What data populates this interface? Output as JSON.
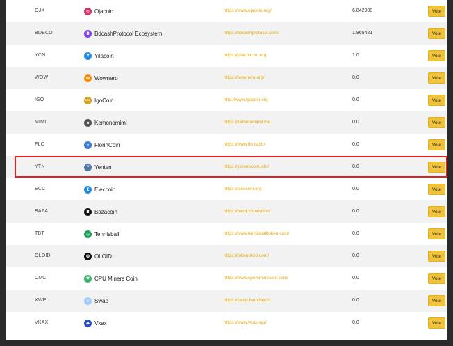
{
  "rows": [
    {
      "ticker": "OJX",
      "name": "Ojacoin",
      "url": "https://www.ojacoin.org/",
      "score": "6.842908",
      "vote": "Vote",
      "icon": "ojacoin-icon",
      "icon_color": "#d6336c",
      "icon_glyph": "∞"
    },
    {
      "ticker": "BDECO",
      "name": "BdcashProtocol Ecosystem",
      "url": "https://bdcashprotocol.com/",
      "score": "1.865421",
      "vote": "Vote",
      "icon": "bdcash-icon",
      "icon_color": "#7b3fe4",
      "icon_glyph": "B"
    },
    {
      "ticker": "YCN",
      "name": "Yilacoin",
      "url": "https://yilacoin.eu.org",
      "score": "1.0",
      "vote": "Vote",
      "icon": "yilacoin-icon",
      "icon_color": "#1e88e5",
      "icon_glyph": "Y"
    },
    {
      "ticker": "WOW",
      "name": "Wownero",
      "url": "https://wownero.org/",
      "score": "0.0",
      "vote": "Vote",
      "icon": "wownero-icon",
      "icon_color": "#ff8a00",
      "icon_glyph": "w"
    },
    {
      "ticker": "IGO",
      "name": "IgoCoin",
      "url": "http://www.igocoin.org",
      "score": "0.0",
      "vote": "Vote",
      "icon": "igocoin-icon",
      "icon_color": "#d4a017",
      "icon_glyph": "IGO"
    },
    {
      "ticker": "MIMI",
      "name": "Kemonomimi",
      "url": "https://kemonomimi.me",
      "score": "0.0",
      "vote": "Vote",
      "icon": "kemonomimi-icon",
      "icon_color": "#555555",
      "icon_glyph": "◆"
    },
    {
      "ticker": "FLO",
      "name": "FlorinCoin",
      "url": "https://www.flo.cash/",
      "score": "0.0",
      "vote": "Vote",
      "icon": "florincoin-icon",
      "icon_color": "#3a7bd5",
      "icon_glyph": "✦"
    },
    {
      "ticker": "YTN",
      "name": "Yenten",
      "url": "https://yentencoin.info/",
      "score": "0.0",
      "vote": "Vote",
      "icon": "yenten-icon",
      "icon_color": "#4a7aa8",
      "icon_glyph": "Y"
    },
    {
      "ticker": "ECC",
      "name": "Eleccoin",
      "url": "https://eleccoin.org",
      "score": "0.0",
      "vote": "Vote",
      "icon": "eleccoin-icon",
      "icon_color": "#1e88e5",
      "icon_glyph": "E"
    },
    {
      "ticker": "BAZA",
      "name": "Bazacoin",
      "url": "https://baza.foundation/",
      "score": "0.0",
      "vote": "Vote",
      "icon": "bazacoin-icon",
      "icon_color": "#111111",
      "icon_glyph": "B"
    },
    {
      "ticker": "TBT",
      "name": "Tennisball",
      "url": "https://www.tennisballtoken.com/",
      "score": "0.0",
      "vote": "Vote",
      "icon": "tennisball-icon",
      "icon_color": "#1b9e5a",
      "icon_glyph": "◎"
    },
    {
      "ticker": "OLOID",
      "name": "OLOID",
      "url": "https://tokenoloid.com/",
      "score": "0.0",
      "vote": "Vote",
      "icon": "oloid-icon",
      "icon_color": "#111111",
      "icon_glyph": "O"
    },
    {
      "ticker": "CMC",
      "name": "CPU Miners Coin",
      "url": "https://www.cpuminerscoin.com/",
      "score": "0.0",
      "vote": "Vote",
      "icon": "cpuminers-icon",
      "icon_color": "#3cb371",
      "icon_glyph": "♥"
    },
    {
      "ticker": "XWP",
      "name": "Swap",
      "url": "https://swap.foundation",
      "score": "0.0",
      "vote": "Vote",
      "icon": "swap-icon",
      "icon_color": "#9ecbff",
      "icon_glyph": "✕"
    },
    {
      "ticker": "VKAX",
      "name": "Vkax",
      "url": "https://www.vkax.xyz/",
      "score": "0.0",
      "vote": "Vote",
      "icon": "vkax-icon",
      "icon_color": "#2b50c8",
      "icon_glyph": "◆"
    }
  ],
  "highlighted_ticker": "YTN"
}
